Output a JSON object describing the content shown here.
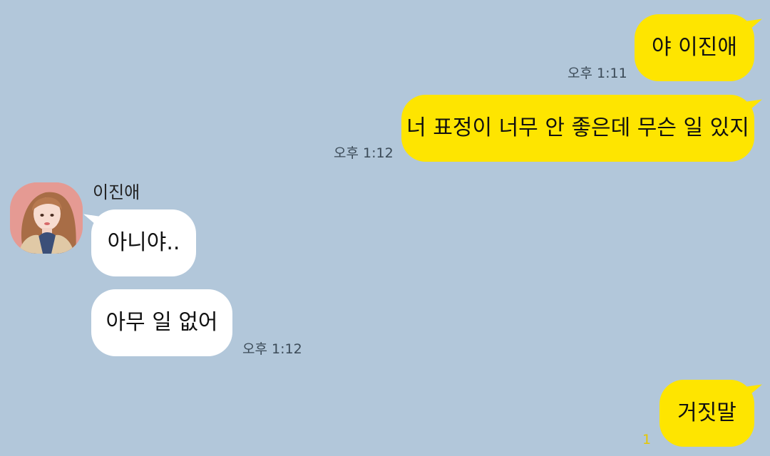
{
  "chat": {
    "partner_name": "이진애",
    "messages": [
      {
        "from": "me",
        "text": "야 이진애",
        "time": "오후 1:11"
      },
      {
        "from": "me",
        "text": "너 표정이 너무 안 좋은데 무슨 일 있지",
        "time": "오후 1:12"
      },
      {
        "from": "them",
        "text": "아니야..",
        "time": ""
      },
      {
        "from": "them",
        "text": "아무 일 없어",
        "time": "오후 1:12"
      },
      {
        "from": "me",
        "text": "거짓말",
        "time": "",
        "unread": "1"
      }
    ]
  },
  "colors": {
    "background": "#b2c7da",
    "my_bubble": "#fee500",
    "their_bubble": "#ffffff",
    "unread_count": "#e6c700"
  },
  "icons": {
    "avatar": "profile-photo"
  }
}
